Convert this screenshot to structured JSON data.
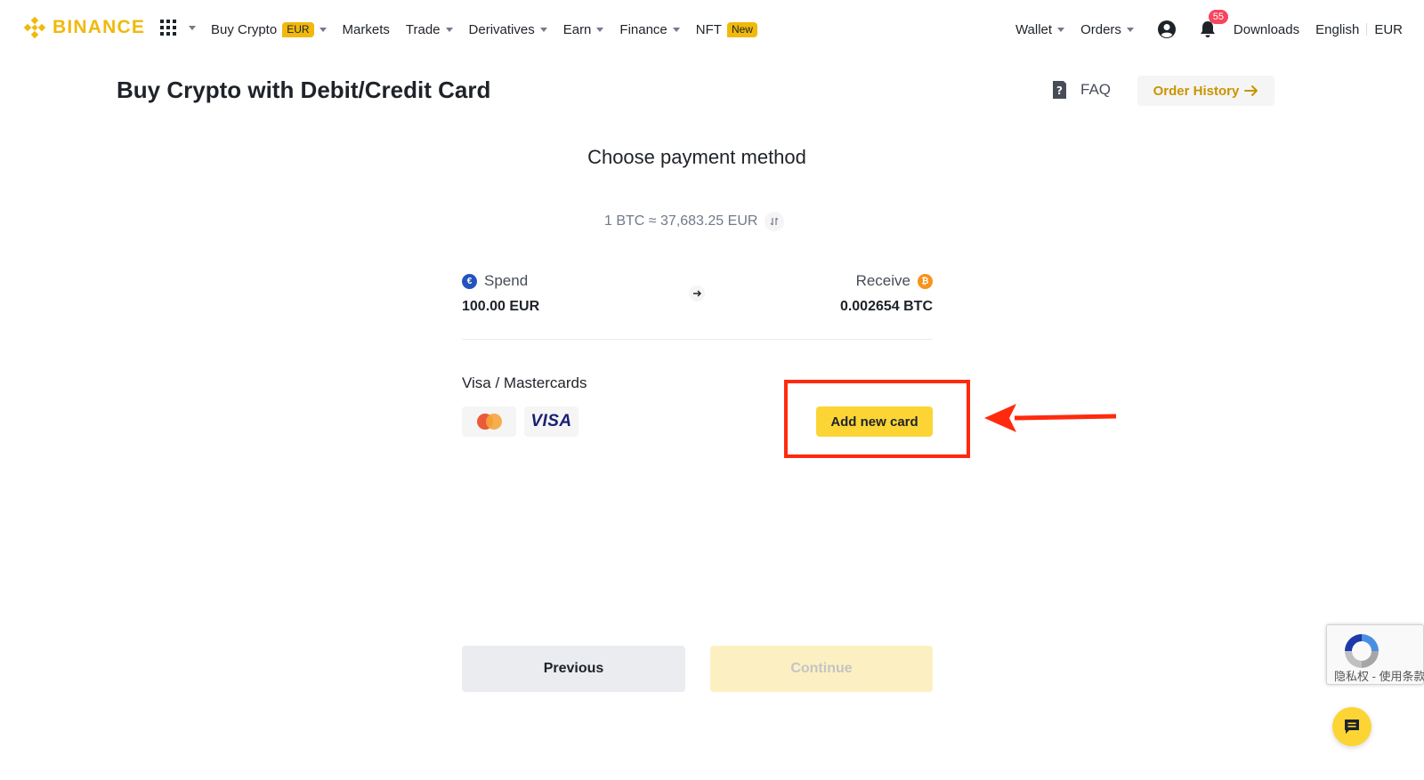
{
  "brand": {
    "name": "BINANCE",
    "color": "#f0b90b"
  },
  "nav": {
    "buy_crypto": "Buy Crypto",
    "buy_crypto_badge": "EUR",
    "markets": "Markets",
    "trade": "Trade",
    "derivatives": "Derivatives",
    "earn": "Earn",
    "finance": "Finance",
    "nft": "NFT",
    "nft_badge": "New",
    "wallet": "Wallet",
    "orders": "Orders",
    "notifications_count": "55",
    "downloads": "Downloads",
    "language": "English",
    "currency": "EUR"
  },
  "header": {
    "title": "Buy Crypto with Debit/Credit Card",
    "faq": "FAQ",
    "order_history": "Order History"
  },
  "main": {
    "section_title": "Choose payment method",
    "rate": "1 BTC ≈ 37,683.25 EUR",
    "spend_label": "Spend",
    "spend_amount": "100.00 EUR",
    "receive_label": "Receive",
    "receive_amount": "0.002654 BTC",
    "cards_title": "Visa / Mastercards",
    "visa_text": "VISA",
    "add_card": "Add new card"
  },
  "footer": {
    "previous": "Previous",
    "continue": "Continue"
  },
  "recaptcha": {
    "text": "隐私权 - 使用条款"
  },
  "colors": {
    "accent_yellow": "#fcd535",
    "highlight_red": "#ff2a0d",
    "order_history_text": "#c99400"
  }
}
